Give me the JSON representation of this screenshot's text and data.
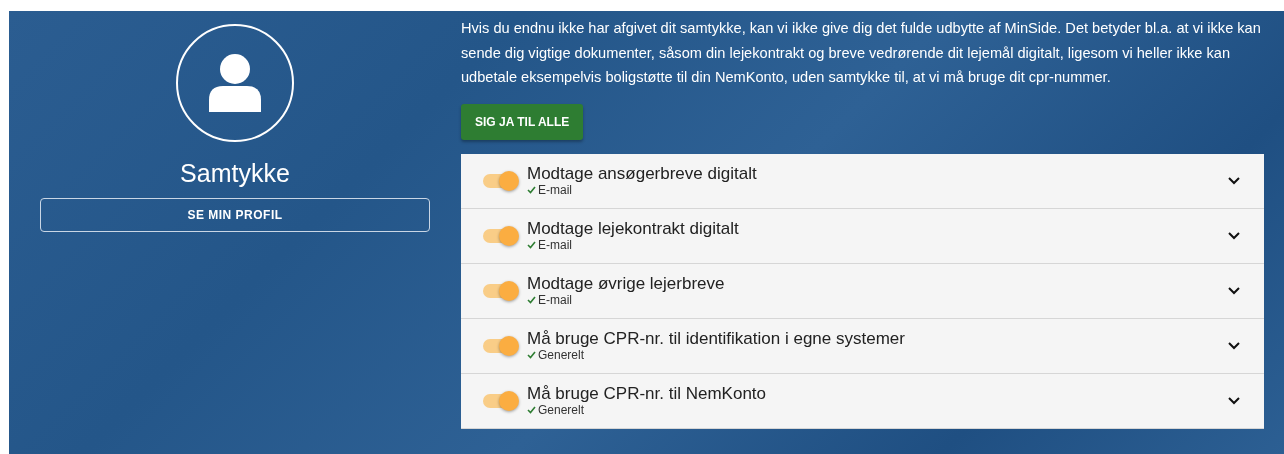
{
  "profile": {
    "title": "Samtykke",
    "button": "SE MIN PROFIL"
  },
  "intro": "Hvis du endnu ikke har afgivet dit samtykke, kan vi ikke give dig det fulde udbytte af MinSide. Det betyder bl.a. at vi ikke kan sende dig vigtige dokumenter, såsom din lejekontrakt og breve vedrørende dit lejemål digitalt, ligesom vi heller ikke kan udbetale eksempelvis boligstøtte til din NemKonto, uden samtykke til, at vi må bruge dit cpr-nummer.",
  "accept_all_button": "SIG JA TIL ALLE",
  "consents": [
    {
      "title": "Modtage ansøgerbreve digitalt",
      "channel": "E-mail",
      "on": true,
      "expanded": false
    },
    {
      "title": "Modtage lejekontrakt digitalt",
      "channel": "E-mail",
      "on": true,
      "expanded": false
    },
    {
      "title": "Modtage øvrige lejerbreve",
      "channel": "E-mail",
      "on": true,
      "expanded": false
    },
    {
      "title": "Må bruge CPR-nr. til identifikation i egne systemer",
      "channel": "Generelt",
      "on": true,
      "expanded": false
    },
    {
      "title": "Må bruge CPR-nr. til NemKonto",
      "channel": "Generelt",
      "on": true,
      "expanded": false
    }
  ]
}
